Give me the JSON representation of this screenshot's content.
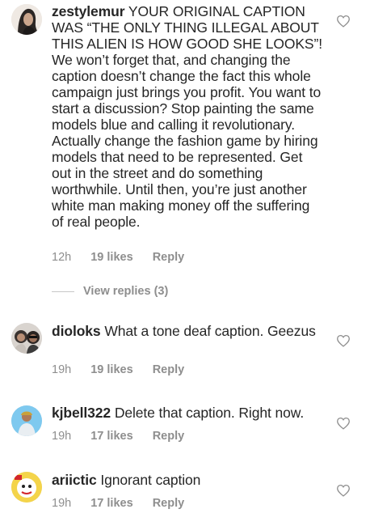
{
  "comments": [
    {
      "username": "zestylemur",
      "text": "YOUR ORIGINAL CAPTION WAS “THE ONLY THING ILLEGAL ABOUT THIS ALIEN IS HOW GOOD SHE LOOKS”! We won’t forget that, and changing the caption doesn’t change the fact this whole campaign just brings you profit. You want to start a discussion? Stop painting the same models blue and calling it revolutionary. Actually change the fashion game by hiring models that need to be represented. Get out in the street and do something worthwhile. Until then, you’re just another white man making money off the suffering of real people.",
      "time": "12h",
      "likes": "19 likes",
      "reply": "Reply"
    },
    {
      "username": "dioloks",
      "text": "What a tone deaf caption. Geezus",
      "time": "19h",
      "likes": "19 likes",
      "reply": "Reply"
    },
    {
      "username": "kjbell322",
      "text": "Delete that caption. Right now.",
      "time": "19h",
      "likes": "17 likes",
      "reply": "Reply"
    },
    {
      "username": "ariictic",
      "text": "Ignorant caption",
      "time": "19h",
      "likes": "17 likes",
      "reply": "Reply"
    }
  ],
  "view_replies": "View replies (3)",
  "icons": {
    "like": "heart-outline-icon"
  },
  "colors": {
    "text": "#262626",
    "meta": "#8e8e8e",
    "divider": "#c7c7c7"
  }
}
